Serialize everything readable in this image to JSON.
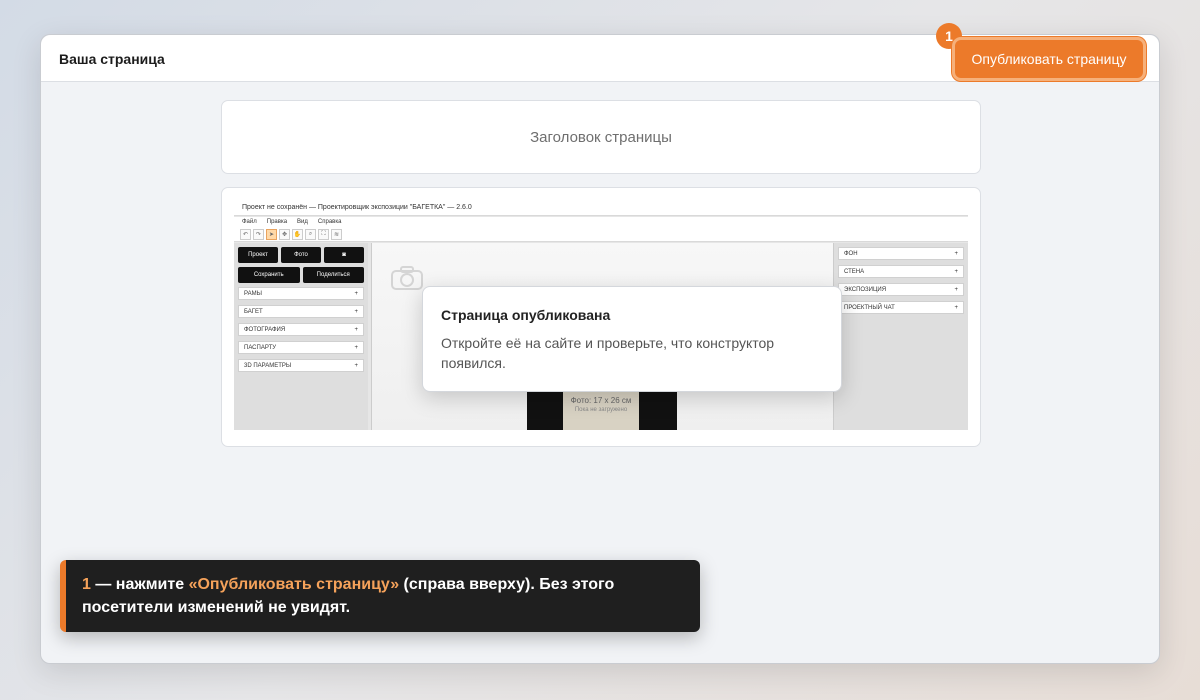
{
  "window": {
    "title": "Ваша страница",
    "publish_label": "Опубликовать страницу",
    "step_number": "1"
  },
  "page_title_placeholder": "Заголовок страницы",
  "screenshot": {
    "app_title": "Проект не сохранён — Проектировщик экспозиции \"БАГЕТКА\" — 2.6.0",
    "menu": [
      "Файл",
      "Правка",
      "Вид",
      "Справка"
    ],
    "left_buttons_row1": [
      "Проект",
      "Фото"
    ],
    "left_buttons_row2": [
      "Сохранить",
      "Поделиться"
    ],
    "left_sections": [
      "РАМЫ",
      "БАГЕТ",
      "ФОТОГРАФИЯ",
      "ПАСПАРТУ",
      "3D ПАРАМЕТРЫ"
    ],
    "right_sections": [
      "ФОН",
      "СТЕНА",
      "ЭКСПОЗИЦИЯ",
      "ПРОЕКТНЫЙ ЧАТ"
    ],
    "frame_photo_label": "Фото: 17 x 26 см",
    "frame_photo_sub": "Пока не загружено"
  },
  "toast": {
    "title": "Страница опубликована",
    "text": "Откройте её на сайте и проверьте, что конструктор появился."
  },
  "hint": {
    "number": "1",
    "dash": " — нажмите ",
    "highlight": "«Опубликовать страницу»",
    "rest": " (справа вверху). Без этого посетители изменений не увидят."
  },
  "colors": {
    "accent": "#ec7a2a",
    "hint_bg": "#1f1f1f"
  }
}
